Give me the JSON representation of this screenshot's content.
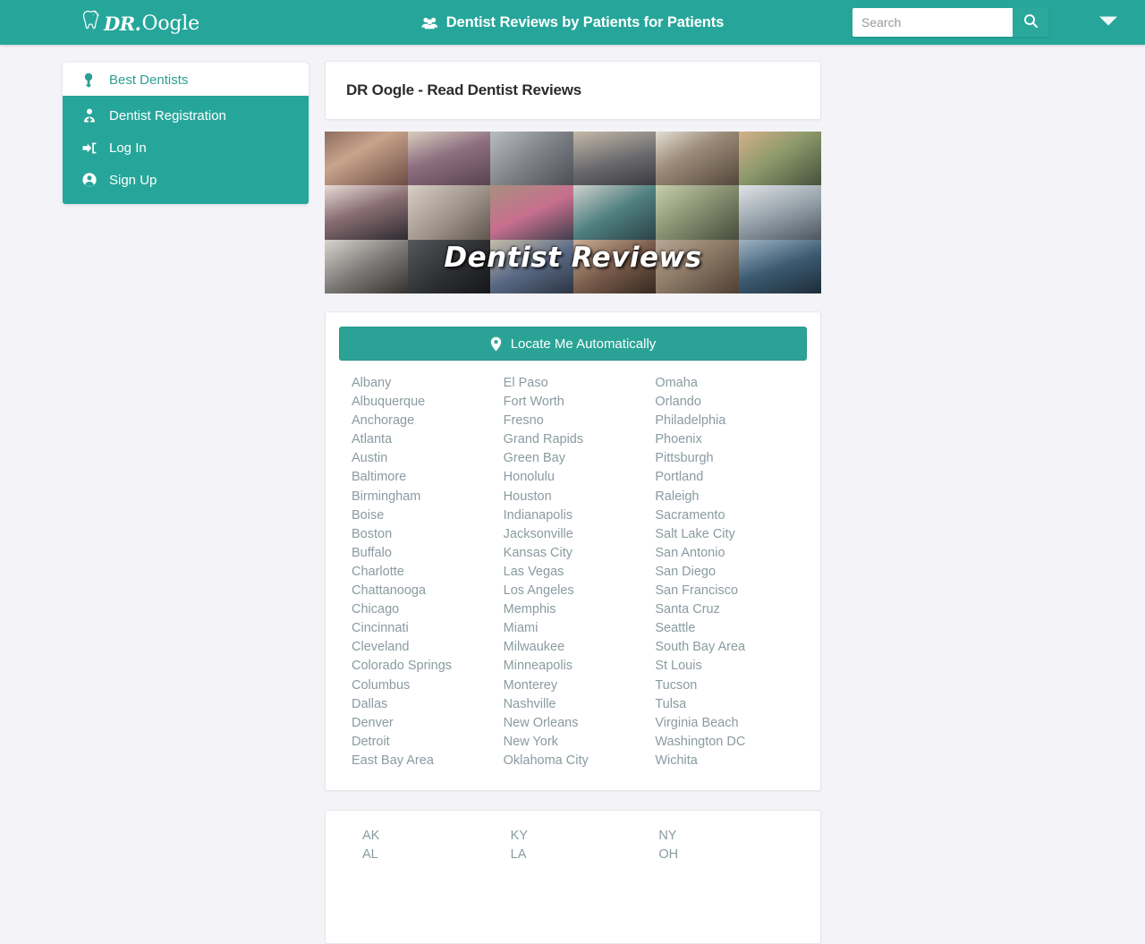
{
  "navbar": {
    "brand_dr": "DR.",
    "brand_oogle": "Oogle",
    "brand_icon": "tooth-icon",
    "title": "Dentist Reviews by Patients for Patients",
    "title_icon": "users-icon",
    "search_placeholder": "Search",
    "search_value": "",
    "search_icon": "search-icon",
    "caret_icon": "chevron-down-icon",
    "bg_color": "#26a69a"
  },
  "sidebar": {
    "items": [
      {
        "label": "Best Dentists",
        "icon": "award-ribbon-icon",
        "active": true
      },
      {
        "label": "Dentist Registration",
        "icon": "user-md-icon",
        "active": false
      },
      {
        "label": "Log In",
        "icon": "sign-in-icon",
        "active": false
      },
      {
        "label": "Sign Up",
        "icon": "user-circle-icon",
        "active": false
      }
    ],
    "active_bg": "#ffffff",
    "active_text_color": "#2e9e93"
  },
  "main": {
    "page_title": "DR Oogle - Read Dentist Reviews",
    "hero_caption": "Dentist Reviews",
    "locate_button": {
      "label": "Locate Me Automatically",
      "icon": "map-pin-icon",
      "color": "#2aa396"
    },
    "cities": {
      "col1": [
        "Albany",
        "Albuquerque",
        "Anchorage",
        "Atlanta",
        "Austin",
        "Baltimore",
        "Birmingham",
        "Boise",
        "Boston",
        "Buffalo",
        "Charlotte",
        "Chattanooga",
        "Chicago",
        "Cincinnati",
        "Cleveland",
        "Colorado Springs",
        "Columbus",
        "Dallas",
        "Denver",
        "Detroit",
        "East Bay Area"
      ],
      "col2": [
        "El Paso",
        "Fort Worth",
        "Fresno",
        "Grand Rapids",
        "Green Bay",
        "Honolulu",
        "Houston",
        "Indianapolis",
        "Jacksonville",
        "Kansas City",
        "Las Vegas",
        "Los Angeles",
        "Memphis",
        "Miami",
        "Milwaukee",
        "Minneapolis",
        "Monterey",
        "Nashville",
        "New Orleans",
        "New York",
        "Oklahoma City"
      ],
      "col3": [
        "Omaha",
        "Orlando",
        "Philadelphia",
        "Phoenix",
        "Pittsburgh",
        "Portland",
        "Raleigh",
        "Sacramento",
        "Salt Lake City",
        "San Antonio",
        "San Diego",
        "San Francisco",
        "Santa Cruz",
        "Seattle",
        "South Bay Area",
        "St Louis",
        "Tucson",
        "Tulsa",
        "Virginia Beach",
        "Washington DC",
        "Wichita"
      ]
    },
    "states": {
      "col1": [
        "AK",
        "AL"
      ],
      "col2": [
        "KY",
        "LA"
      ],
      "col3": [
        "NY",
        "OH"
      ]
    }
  },
  "theme": {
    "page_bg": "#f4f4f8",
    "teal": "#26a69a",
    "link_color": "#8a9ba0"
  }
}
